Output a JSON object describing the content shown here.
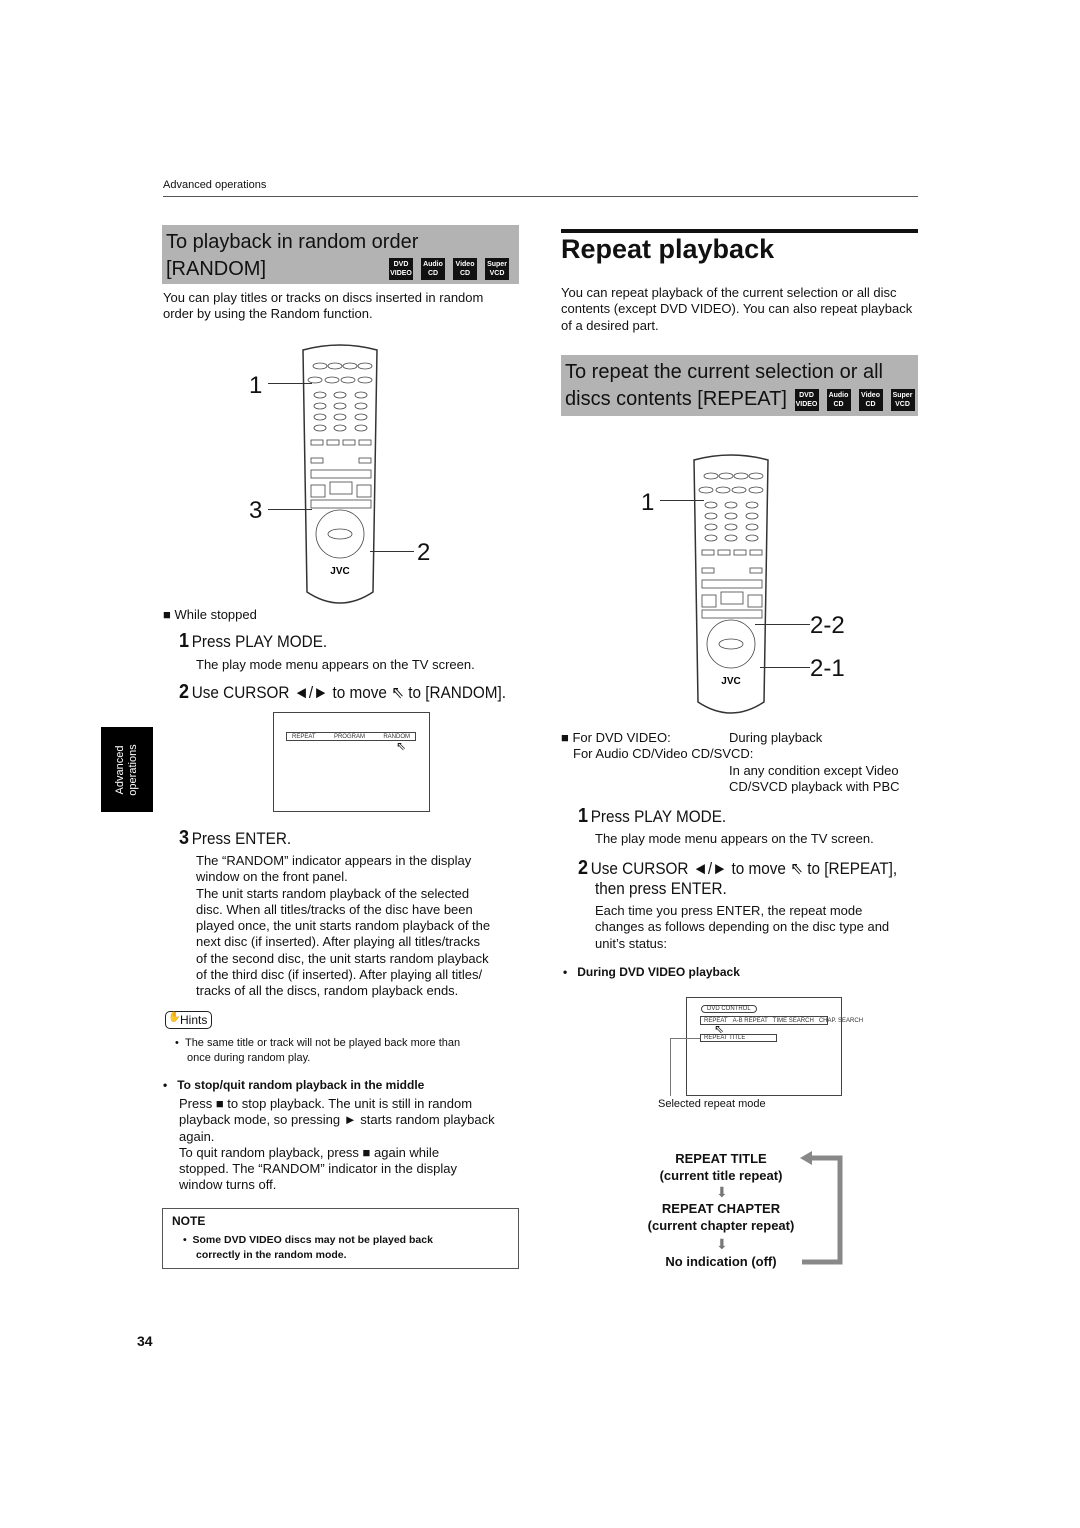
{
  "header": {
    "section": "Advanced operations",
    "page_number": "34",
    "side_tab": [
      "Advanced",
      "operations"
    ]
  },
  "badges": [
    [
      "DVD",
      "VIDEO"
    ],
    [
      "Audio",
      "CD"
    ],
    [
      "Video",
      "CD"
    ],
    [
      "Super",
      "VCD"
    ]
  ],
  "remote": {
    "logo": "JVC"
  },
  "left": {
    "title_line1": "To playback  in random order",
    "title_line2": "[RANDOM]",
    "intro": [
      "You can play titles or tracks on discs inserted in random",
      "order by using the Random function."
    ],
    "callouts": [
      "1",
      "3",
      "2"
    ],
    "condition": "■ While stopped",
    "step1": {
      "num": "1",
      "text": "Press PLAY MODE.",
      "desc": "The play mode menu appears on the TV screen."
    },
    "step2": {
      "num": "2",
      "text": "Use CURSOR ◄/► to move ⇖ to [RANDOM]."
    },
    "osd": [
      "REPEAT",
      "PROGRAM",
      "RANDOM"
    ],
    "step3": {
      "num": "3",
      "text": "Press ENTER.",
      "desc": [
        "The “RANDOM” indicator appears in the display",
        "window on the front panel.",
        "The unit starts random playback of the selected",
        "disc. When all titles/tracks of the disc have been",
        "played once, the unit starts random playback of the",
        "next disc (if inserted). After playing all titles/tracks",
        "of the second disc, the unit starts random playback",
        "of the third disc (if inserted). After playing all titles/",
        "tracks of all the discs, random playback ends."
      ]
    },
    "hints_label": "Hints",
    "hints": [
      "The same title or track will not be played back more than",
      "once during random play."
    ],
    "stop_heading": "To stop/quit random playback in the middle",
    "stop_text": [
      "Press ■ to stop playback. The unit is still in random",
      "playback mode, so pressing ► starts random playback",
      "again.",
      "To quit random playback, press ■ again while",
      "stopped.  The “RANDOM” indicator in the display",
      "window turns off."
    ],
    "note_label": "NOTE",
    "note": [
      "Some DVD VIDEO discs may not be played back",
      "correctly in the random mode."
    ]
  },
  "right": {
    "title": "Repeat playback",
    "intro": [
      "You can repeat playback of the current selection or all disc",
      "contents (except DVD VIDEO). You can also repeat playback",
      "of a desired part."
    ],
    "box_line1": "To repeat the current selection or all",
    "box_line2": "discs contents [REPEAT]",
    "callouts": [
      "1",
      "2-2",
      "2-1"
    ],
    "cond_dvd_label": "■ For DVD VIDEO:",
    "cond_dvd_value": "During playback",
    "cond_cd_label": "For Audio CD/Video CD/SVCD:",
    "cond_cd_value": [
      "In any condition except Video",
      "CD/SVCD playback with PBC"
    ],
    "step1": {
      "num": "1",
      "text": "Press PLAY MODE.",
      "desc": "The play mode menu appears on the TV screen."
    },
    "step2": {
      "num": "2",
      "text": "Use CURSOR ◄/► to move ⇖ to [REPEAT],",
      "text2": "then press ENTER.",
      "desc": [
        "Each time you press ENTER, the repeat mode",
        "changes as follows depending on the disc type and",
        "unit’s status:"
      ]
    },
    "dvd_heading": "During DVD VIDEO playback",
    "osd": {
      "control": "DVD CONTROL",
      "menu": [
        "REPEAT",
        "A-B REPEAT",
        "TIME SEARCH",
        "CHAP. SEARCH"
      ],
      "selected": "REPEAT  TITLE"
    },
    "osd_caption": "Selected repeat mode",
    "flow": [
      {
        "mode": "REPEAT TITLE",
        "desc": "(current title repeat)"
      },
      {
        "mode": "REPEAT CHAPTER",
        "desc": "(current chapter repeat)"
      },
      {
        "mode": "No indication (off)"
      }
    ]
  }
}
